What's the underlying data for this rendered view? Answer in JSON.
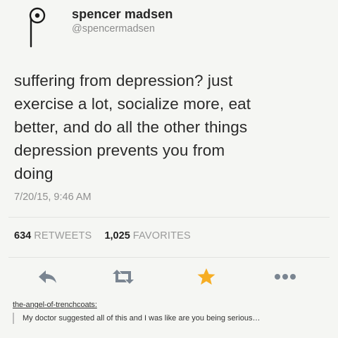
{
  "tweet": {
    "display_name": "spencer madsen",
    "handle": "@spencermadsen",
    "avatar_icon": "letter-p-icon",
    "text_lines": [
      "suffering from depression? just",
      "exercise a lot, socialize more, eat",
      "better, and do all the other things",
      "depression prevents you from",
      "doing"
    ],
    "timestamp": "7/20/15, 9:46 AM",
    "stats": {
      "retweets_count": "634",
      "retweets_label": "RETWEETS",
      "favorites_count": "1,025",
      "favorites_label": "FAVORITES"
    },
    "actions": {
      "reply_icon": "reply-icon",
      "retweet_icon": "retweet-icon",
      "favorite_icon": "star-icon",
      "more_icon": "more-dots-icon"
    },
    "colors": {
      "icon_gray": "#7a8591",
      "favorite_star": "#f6ad23"
    }
  },
  "comment": {
    "author": "the-angel-of-trenchcoats:",
    "text": "My doctor suggested all of this and I was like are you being serious…"
  }
}
